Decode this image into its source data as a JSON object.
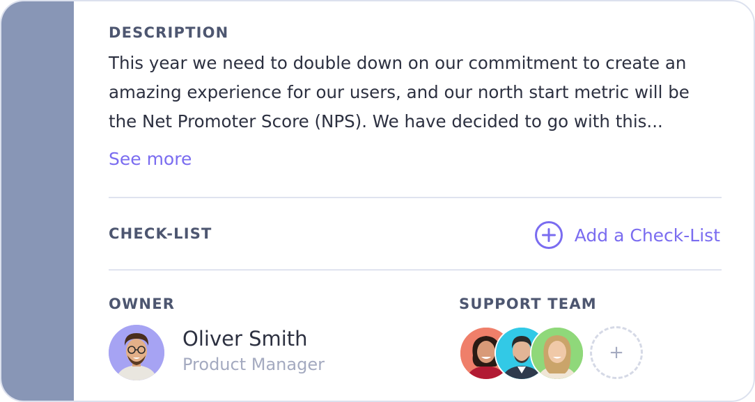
{
  "description": {
    "label": "DESCRIPTION",
    "lines": [
      "This year we need to double down on our commitment to create an",
      "amazing experience for our users, and our north start metric will be",
      "the Net Promoter Score (NPS). We have decided to go with this..."
    ],
    "see_more": "See more"
  },
  "checklist": {
    "label": "CHECK-LIST",
    "add_label": "Add a Check-List",
    "add_icon": "plus-circle-icon"
  },
  "owner": {
    "label": "OWNER",
    "name": "Oliver Smith",
    "role": "Product Manager",
    "avatar_bg": "#a6a3f3"
  },
  "support_team": {
    "label": "SUPPORT TEAM",
    "members": [
      {
        "avatar_bg": "#ef7f6a"
      },
      {
        "avatar_bg": "#32c9e6"
      },
      {
        "avatar_bg": "#8fd87a"
      }
    ],
    "add_symbol": "+"
  },
  "colors": {
    "accent": "#7a6cf0",
    "sidebar": "#8896b6",
    "label": "#4d5670",
    "text": "#2c3040",
    "muted": "#a4aac0"
  }
}
